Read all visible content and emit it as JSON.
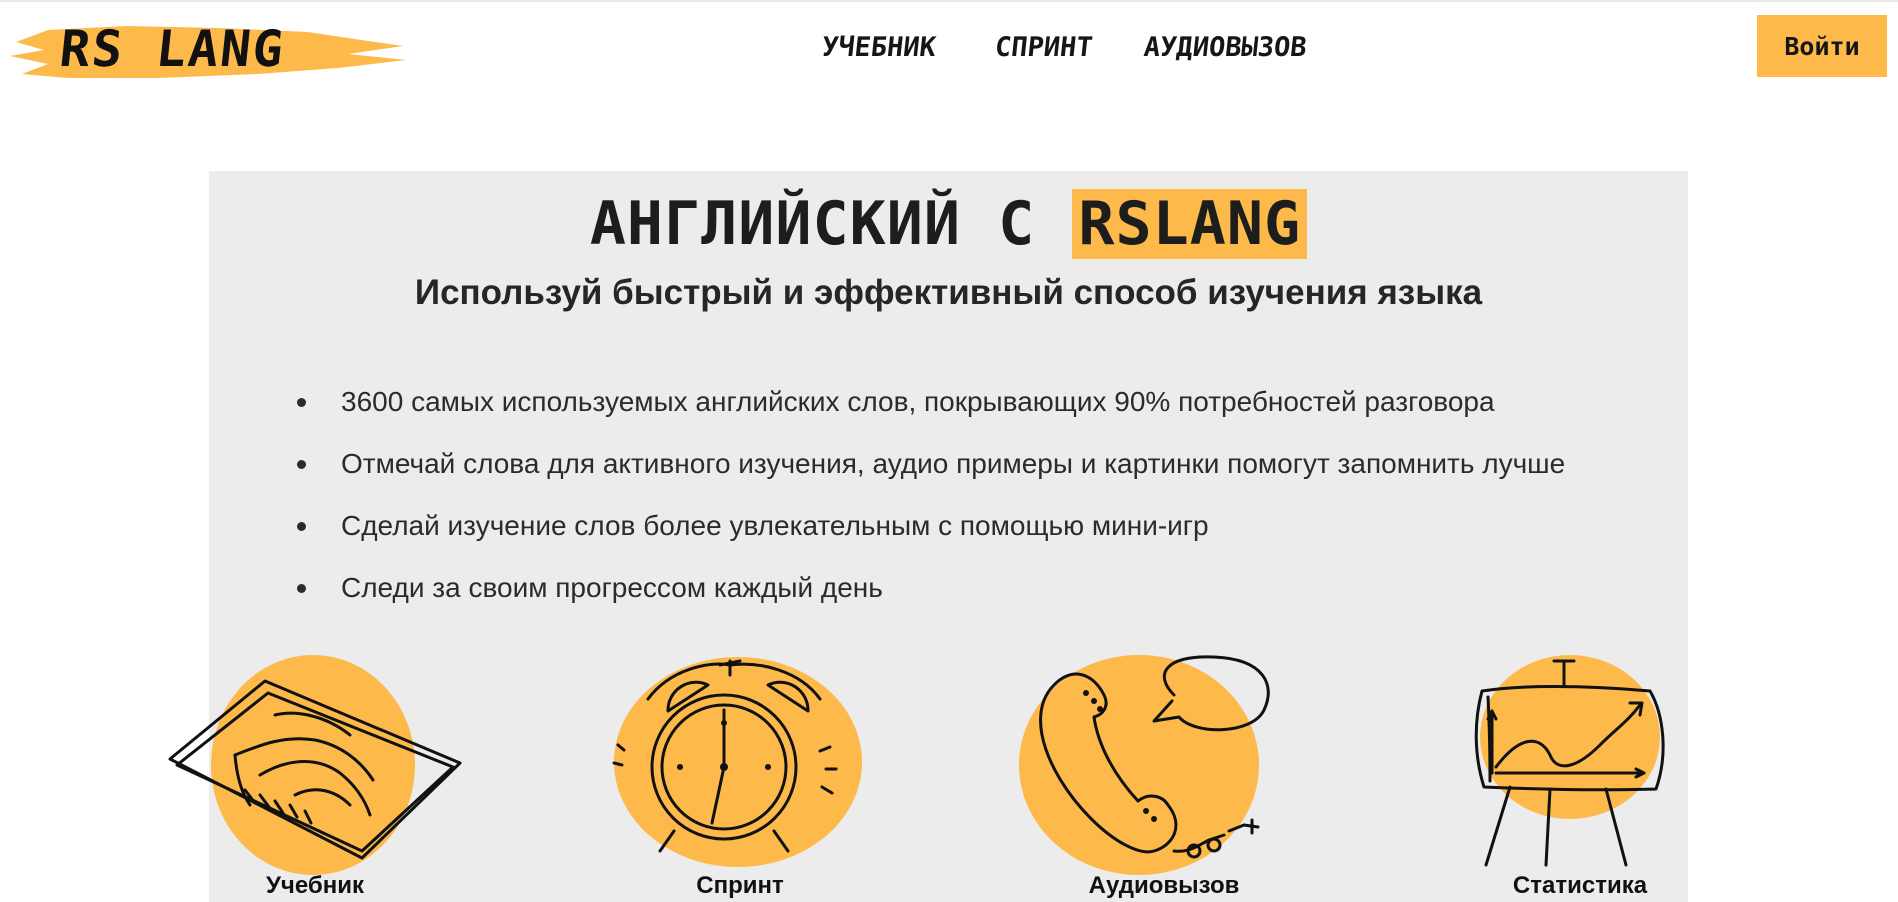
{
  "colors": {
    "accent": "#fdba4b",
    "hero_bg": "#ececec",
    "text": "#1c1c1c"
  },
  "header": {
    "logo_text": "RS LANG",
    "nav": [
      {
        "label": "Учебник"
      },
      {
        "label": "Спринт"
      },
      {
        "label": "Аудиовызов"
      }
    ],
    "login_label": "Войти"
  },
  "hero": {
    "title_prefix": "Английский с",
    "title_highlight": "RSLang",
    "subtitle": "Используй быстрый и эффективный способ изучения языка",
    "features": [
      "3600 самых используемых английских слов, покрывающих 90% потребностей разговора",
      "Отмечай слова для активного изучения, аудио примеры и картинки помогут запомнить лучше",
      "Сделай изучение слов более увлекательным с помощью мини-игр",
      "Следи за своим прогрессом каждый день"
    ]
  },
  "cards": [
    {
      "label": "Учебник",
      "icon": "book-icon"
    },
    {
      "label": "Спринт",
      "icon": "alarm-clock-icon"
    },
    {
      "label": "Аудиовызов",
      "icon": "telephone-icon"
    },
    {
      "label": "Статистика",
      "icon": "chart-easel-icon"
    }
  ]
}
